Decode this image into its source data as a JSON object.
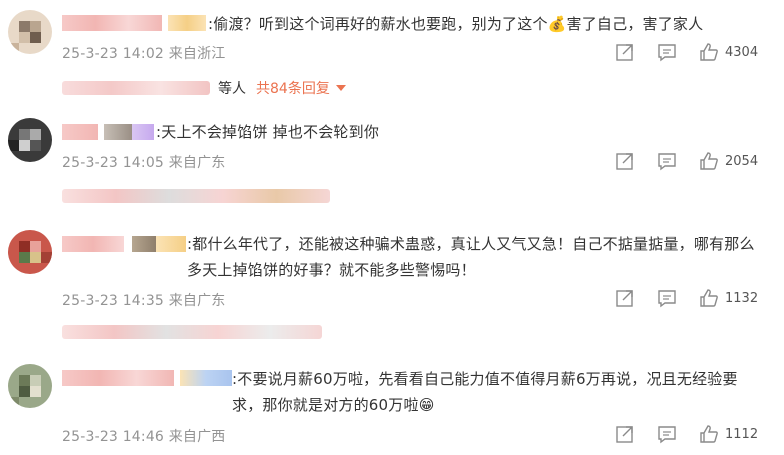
{
  "comments": [
    {
      "text": ":偷渡？听到这个词再好的薪水也要跑，别为了这个💰害了自己，害了家人",
      "date": "25-3-23 14:02",
      "location": "来自浙江",
      "likes": "4304",
      "replies": {
        "suffix": "等人",
        "count_label": "共84条回复"
      }
    },
    {
      "text": ":天上不会掉馅饼 掉也不会轮到你",
      "date": "25-3-23 14:05",
      "location": "来自广东",
      "likes": "2054"
    },
    {
      "text": ":都什么年代了，还能被这种骗术蛊惑，真让人又气又急！自己不掂量掂量，哪有那么多天上掉馅饼的好事？就不能多些警惕吗！",
      "date": "25-3-23 14:35",
      "location": "来自广东",
      "likes": "1132"
    },
    {
      "text": ":不要说月薪60万啦，先看看自己能力值不值得月薪6万再说，况且无经验要求，那你就是对方的60万啦😁",
      "date": "25-3-23 14:46",
      "location": "来自广西",
      "likes": "1112"
    }
  ],
  "icons": [
    "share-icon",
    "comment-icon",
    "like-icon"
  ]
}
